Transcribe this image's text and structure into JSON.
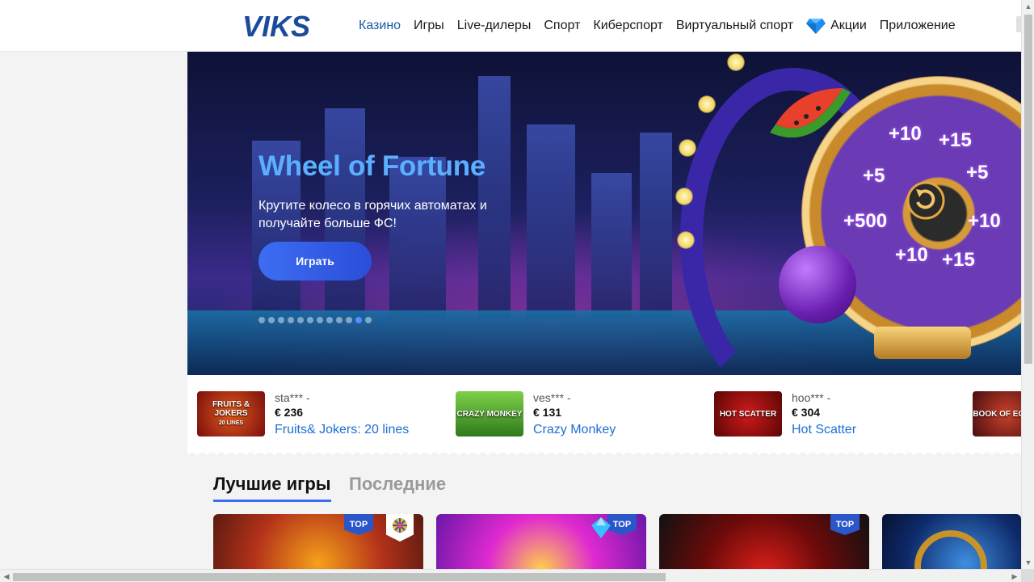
{
  "header": {
    "logo": "VIKS",
    "nav": [
      {
        "label": "Казино",
        "active": true
      },
      {
        "label": "Игры"
      },
      {
        "label": "Live-дилеры"
      },
      {
        "label": "Спорт"
      },
      {
        "label": "Киберспорт"
      },
      {
        "label": "Виртуальный спорт"
      },
      {
        "label": "Акции",
        "icon": "diamond-icon"
      },
      {
        "label": "Приложение"
      }
    ]
  },
  "banner": {
    "title": "Wheel of Fortune",
    "text": "Крутите колесо в горячих автоматах и получайте больше ФС!",
    "button": "Играть",
    "slides_total": 12,
    "active_slide": 11,
    "wheel_values": [
      "+10",
      "+15",
      "+5",
      "+10",
      "+15",
      "+10",
      "+500",
      "+5"
    ]
  },
  "winners": [
    {
      "user": "sta*** -",
      "amount": "€ 236",
      "game": "Fruits& Jokers: 20 lines",
      "thumb_text": "FRUITS & JOKERS",
      "thumb_sub": "20 LINES"
    },
    {
      "user": "ves*** -",
      "amount": "€ 131",
      "game": "Crazy Monkey",
      "thumb_text": "CRAZY MONKEY"
    },
    {
      "user": "hoo*** -",
      "amount": "€ 304",
      "game": "Hot Scatter",
      "thumb_text": "HOT SCATTER"
    },
    {
      "thumb_text": "BOOK OF EGYPT"
    }
  ],
  "tabs": {
    "best": "Лучшие игры",
    "recent": "Последние"
  },
  "cards": [
    {
      "badge": "TOP"
    },
    {
      "badge": "TOP"
    },
    {
      "badge": "TOP"
    },
    {}
  ],
  "colors": {
    "accent": "#3d6df2",
    "nav_active": "#1c5aa6",
    "link": "#1c6fd4",
    "badge": "#2a56c9"
  }
}
